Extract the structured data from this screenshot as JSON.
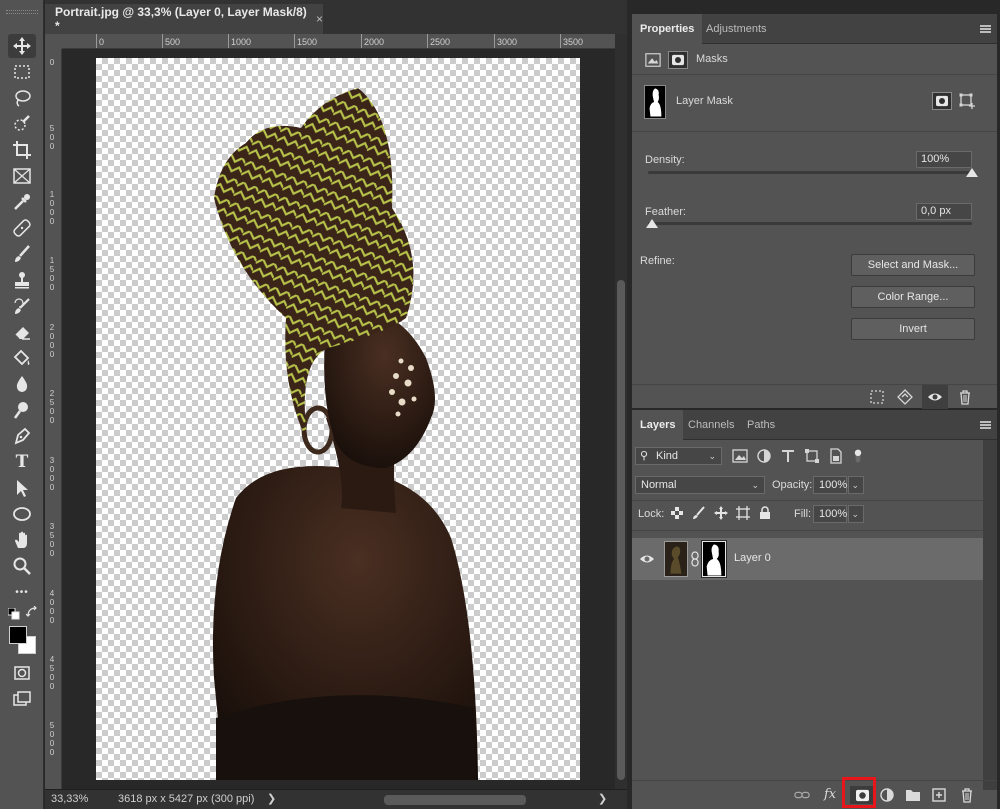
{
  "document": {
    "tab_title": "Portrait.jpg @ 33,3% (Layer 0, Layer Mask/8) *",
    "tab_close": "×",
    "ruler_top": [
      "0",
      "500",
      "1000",
      "1500",
      "2000",
      "2500",
      "3000",
      "3500"
    ],
    "ruler_left": [
      "0",
      "500",
      "1000",
      "1500",
      "2000",
      "2500",
      "3000",
      "3500",
      "4000",
      "4500",
      "5000"
    ],
    "zoom": "33,33%",
    "dimensions": "3618 px x 5427 px (300 ppi)",
    "status_arrow": "❯",
    "scroll_right": "❯"
  },
  "toolbar": {
    "tools": [
      "move-tool",
      "marquee-tool",
      "lasso-tool",
      "quick-selection-tool",
      "crop-tool",
      "frame-tool",
      "eyedropper-tool",
      "healing-brush-tool",
      "brush-tool",
      "clone-stamp-tool",
      "history-brush-tool",
      "eraser-tool",
      "paint-bucket-tool",
      "blur-tool",
      "dodge-tool",
      "pen-tool",
      "type-tool",
      "path-selection-tool",
      "ellipse-tool",
      "hand-tool",
      "zoom-tool",
      "more-tools"
    ],
    "type_tool_letter": "T",
    "more_tools_label": "•••",
    "foreground_color": "#000000",
    "background_color": "#ffffff"
  },
  "properties": {
    "tabs": [
      "Properties",
      "Adjustments"
    ],
    "section_label": "Masks",
    "layer_mask_label": "Layer Mask",
    "density_label": "Density:",
    "density_value": "100%",
    "density_level": 1.0,
    "feather_label": "Feather:",
    "feather_value": "0,0 px",
    "feather_level": 0.0,
    "refine_label": "Refine:",
    "select_and_mask": "Select and Mask...",
    "color_range": "Color Range...",
    "invert": "Invert"
  },
  "layers": {
    "tabs": [
      "Layers",
      "Channels",
      "Paths"
    ],
    "filter_kind": "Kind",
    "blend_mode": "Normal",
    "opacity_label": "Opacity:",
    "opacity_value": "100%",
    "lock_label": "Lock:",
    "fill_label": "Fill:",
    "fill_value": "100%",
    "layer_name": "Layer 0",
    "footer_fx": "fx"
  },
  "colors": {
    "panel_bg": "#535353",
    "tab_bg": "#424242",
    "highlight": "#e8151b",
    "headwrap_base": "#3b2418",
    "headwrap_pattern": "#b6c24a"
  }
}
